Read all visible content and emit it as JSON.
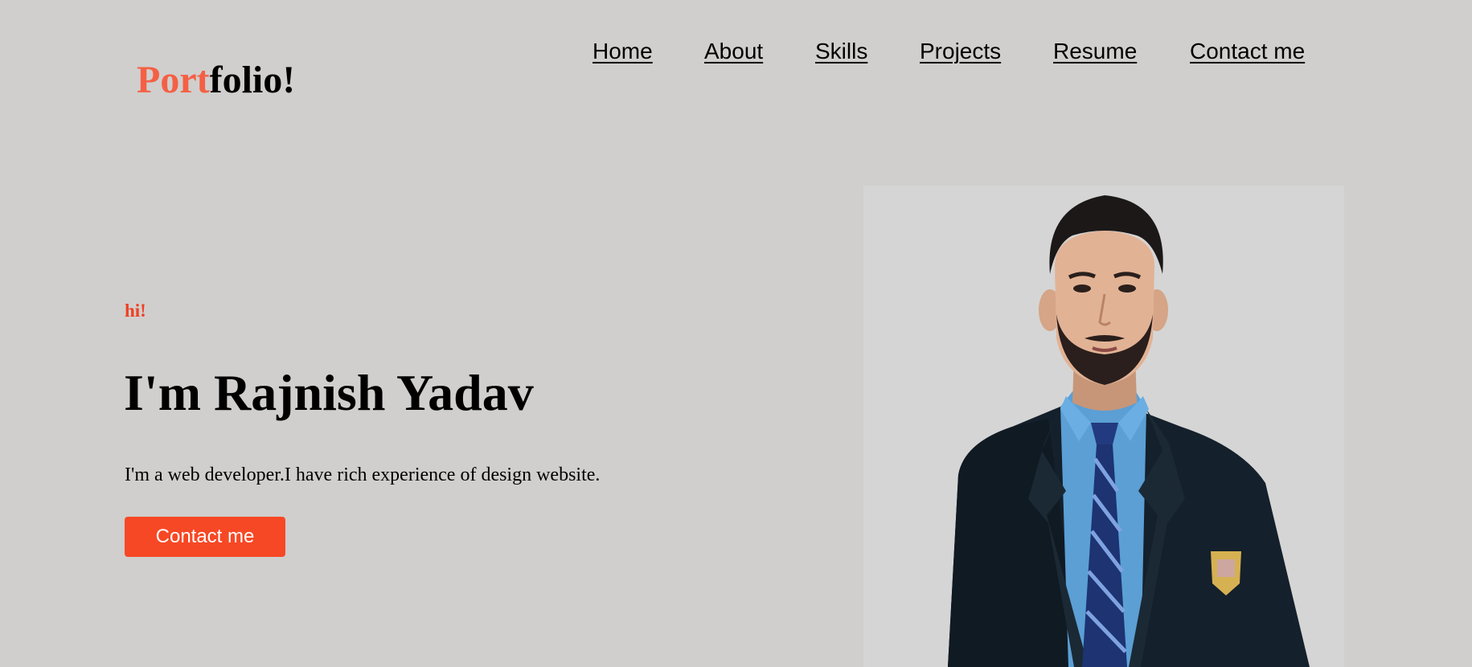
{
  "brand": {
    "accent_part": "Port",
    "rest_part": "folio!",
    "accent_color": "#f46045"
  },
  "nav": {
    "items": [
      {
        "label": "Home"
      },
      {
        "label": "About"
      },
      {
        "label": "Skills"
      },
      {
        "label": "Projects"
      },
      {
        "label": "Resume"
      },
      {
        "label": "Contact me"
      }
    ]
  },
  "hero": {
    "greeting": "hi!",
    "headline": "I'm Rajnish Yadav",
    "intro": "I'm a web developer.I have rich experience of design website.",
    "cta_label": "Contact me",
    "cta_color": "#f74825",
    "greeting_color": "#ef3f22"
  },
  "profile_photo": {
    "icon": "person-portrait-photo"
  },
  "colors": {
    "background": "#d0cfcd",
    "photo_background": "#d5d5d5"
  }
}
